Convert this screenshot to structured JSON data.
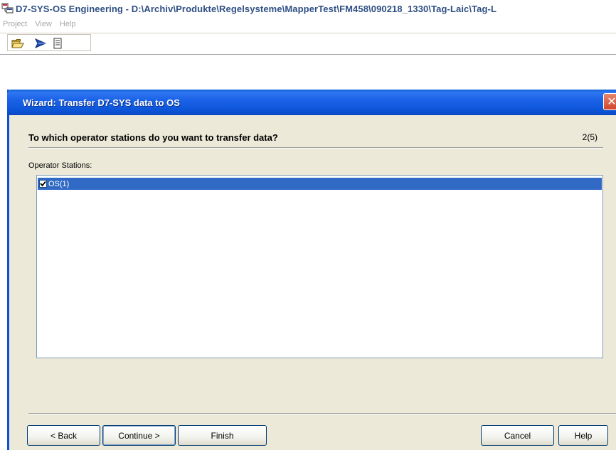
{
  "app": {
    "title": "D7-SYS-OS Engineering - D:\\Archiv\\Produkte\\Regelsysteme\\MapperTest\\FM458\\090218_1330\\Tag-Laic\\Tag-L",
    "icon": "app-window-icon"
  },
  "menu": {
    "items": [
      {
        "label": "Project"
      },
      {
        "label": "View"
      },
      {
        "label": "Help"
      }
    ]
  },
  "toolbar": {
    "buttons": [
      {
        "icon": "open-folder-icon"
      },
      {
        "icon": "transfer-arrow-icon"
      },
      {
        "icon": "document-icon"
      }
    ]
  },
  "wizard": {
    "title": "Wizard: Transfer D7-SYS data to OS",
    "close_label": "✕",
    "question": "To which operator stations do you want to transfer data?",
    "step": "2(5)",
    "list_label": "Operator Stations:",
    "stations": [
      {
        "label": "OS(1)",
        "checked": true,
        "selected": true
      }
    ],
    "buttons": {
      "back": "< Back",
      "continue": "Continue >",
      "finish": "Finish",
      "cancel": "Cancel",
      "help": "Help"
    }
  },
  "colors": {
    "titlebar_text": "#2f4f84",
    "wizard_titlebar": "#0d55d8",
    "selection": "#316ac5",
    "dialog_bg": "#ece9d8"
  }
}
